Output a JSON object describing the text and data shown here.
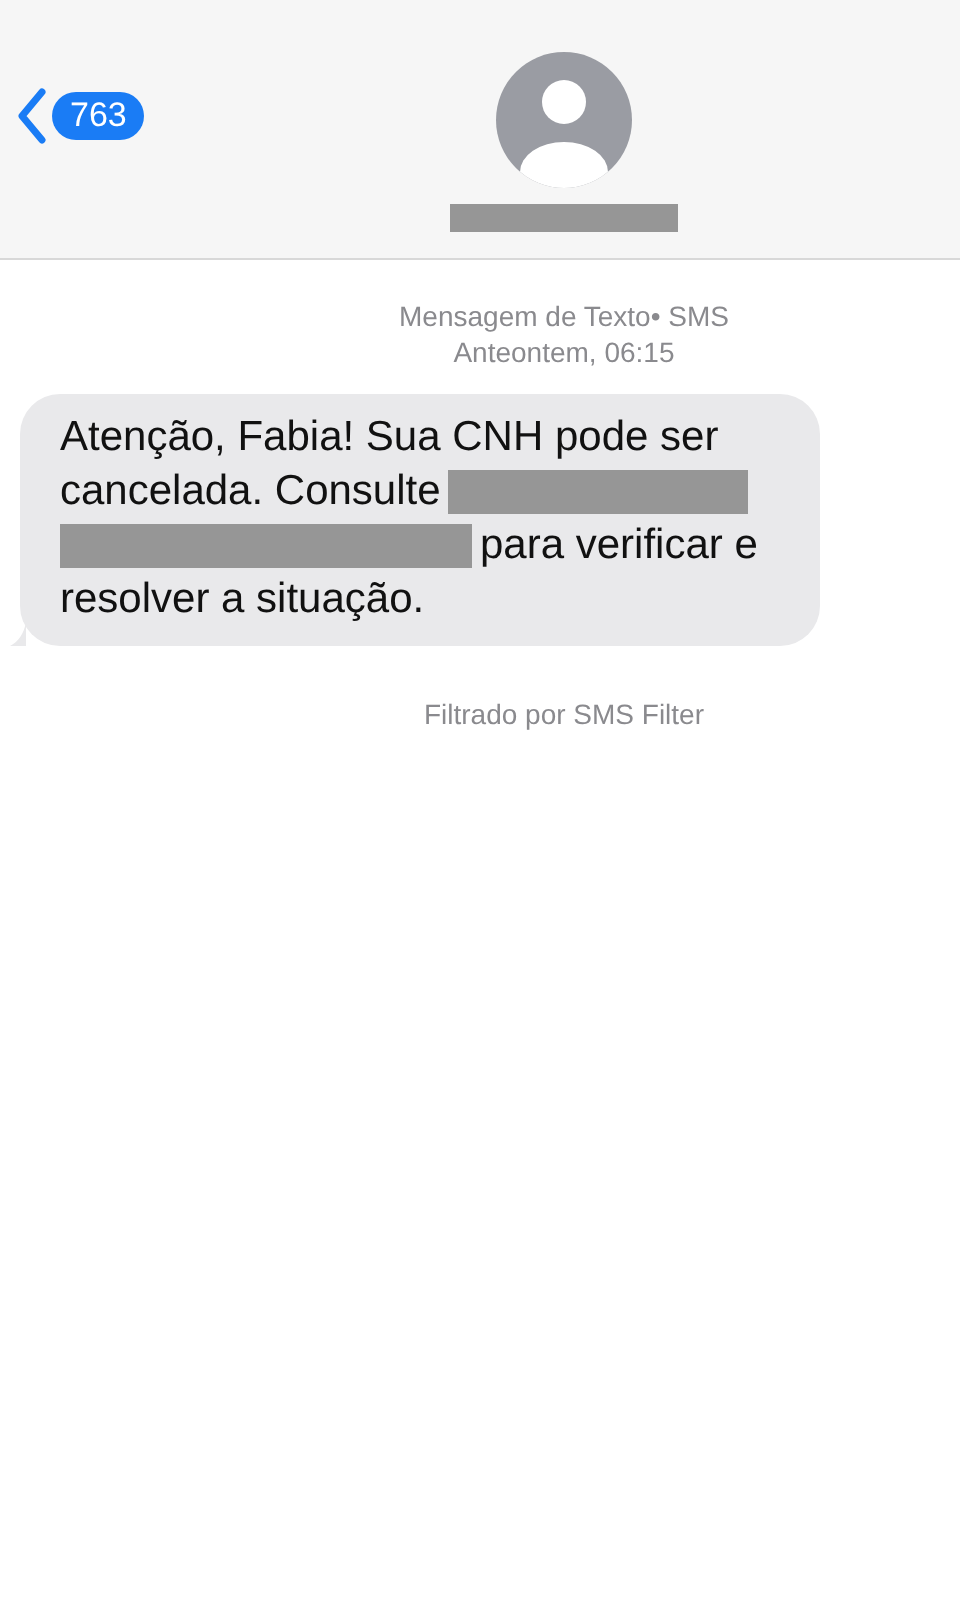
{
  "header": {
    "back_count": "763",
    "contact_name": {
      "kind": "redacted"
    }
  },
  "meta": {
    "service": "Mensagem de Texto• SMS",
    "time": "Anteontem, 06:15"
  },
  "message": {
    "lines": [
      [
        {
          "kind": "text",
          "text": "Atenção, Fabia! Sua CNH pode ser"
        }
      ],
      [
        {
          "kind": "text",
          "text": "cancelada. Consulte"
        },
        {
          "kind": "redacted"
        }
      ],
      [
        {
          "kind": "redacted"
        },
        {
          "kind": "text",
          "text": "para verificar e"
        }
      ],
      [
        {
          "kind": "text",
          "text": "resolver a situação."
        }
      ]
    ]
  },
  "filter_note": "Filtrado por SMS Filter"
}
